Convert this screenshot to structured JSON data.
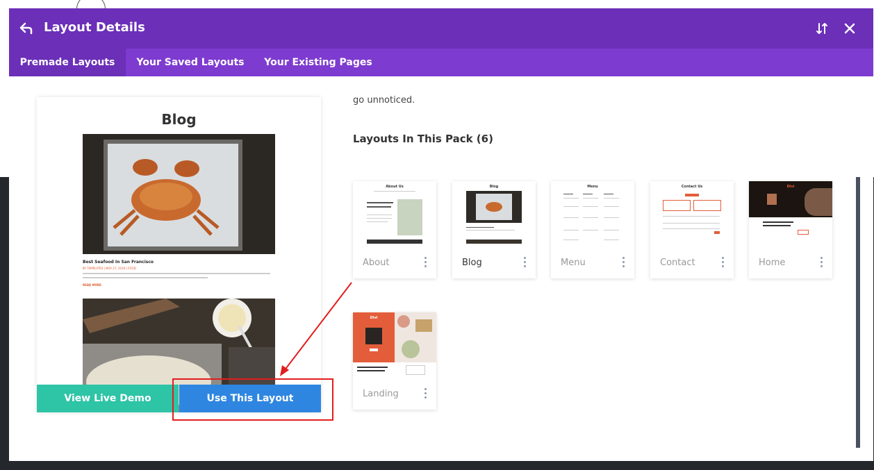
{
  "header": {
    "title": "Layout Details"
  },
  "tabs": [
    {
      "label": "Premade Layouts",
      "active": true
    },
    {
      "label": "Your Saved Layouts",
      "active": false
    },
    {
      "label": "Your Existing Pages",
      "active": false
    }
  ],
  "preview": {
    "title": "Blog",
    "post_title": "Best Seafood In San Francisco",
    "post_meta": "BY TEMPLATES | NOV 27, 2018 | FOOD",
    "read_more": "READ MORE",
    "view_demo_label": "View Live Demo",
    "use_layout_label": "Use This Layout"
  },
  "details": {
    "description_tail": "go unnoticed.",
    "pack_heading": "Layouts In This Pack (6)"
  },
  "layouts": [
    {
      "label": "About",
      "thumb_title": "About Us",
      "selected": false
    },
    {
      "label": "Blog",
      "thumb_title": "Blog",
      "selected": true
    },
    {
      "label": "Menu",
      "thumb_title": "Menu",
      "selected": false
    },
    {
      "label": "Contact",
      "thumb_title": "Contact Us",
      "selected": false
    },
    {
      "label": "Home",
      "thumb_title": "Divi",
      "selected": false
    },
    {
      "label": "Landing",
      "thumb_title": "Divi",
      "selected": false
    }
  ],
  "colors": {
    "header": "#6b2fb8",
    "tabs": "#7e3bd0",
    "demo_button": "#2ec4a6",
    "use_button": "#2f86e0",
    "annotation": "#e31d1d"
  }
}
